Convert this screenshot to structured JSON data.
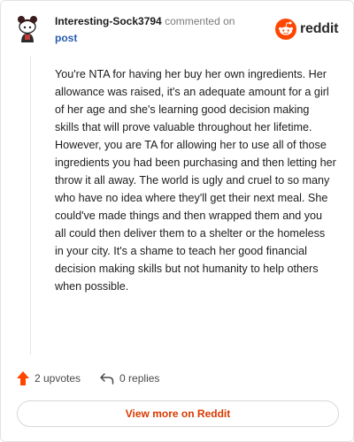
{
  "comment": {
    "username": "Interesting-Sock3794",
    "action_text": "commented on",
    "post_link": "post",
    "body": "You're NTA for having her buy her own ingredients. Her allowance was raised, it's an adequate amount for a girl of her age and she's learning good decision making skills that will prove valuable throughout her lifetime. However, you are TA for allowing her to use all of those ingredients you had been purchasing and then letting her throw it all away. The world is ugly and cruel to so many who have no idea where they'll get their next meal. She could've made things and then wrapped them and you all could then deliver them to a shelter or the homeless in your city. It's a shame to teach her good financial decision making skills but not humanity to help others when possible.",
    "upvotes": "2 upvotes",
    "replies": "0 replies"
  },
  "brand": {
    "name": "reddit",
    "color": "#ff4500"
  },
  "footer": {
    "view_more": "View more on Reddit"
  },
  "icons": {
    "avatar": "snoo-avatar-icon",
    "logo": "reddit-logo-icon",
    "upvote": "upvote-arrow-icon",
    "reply": "reply-arrow-icon"
  },
  "colors": {
    "link": "#2a5db0",
    "upvote": "#ff4500",
    "view_more_text": "#d93900"
  }
}
